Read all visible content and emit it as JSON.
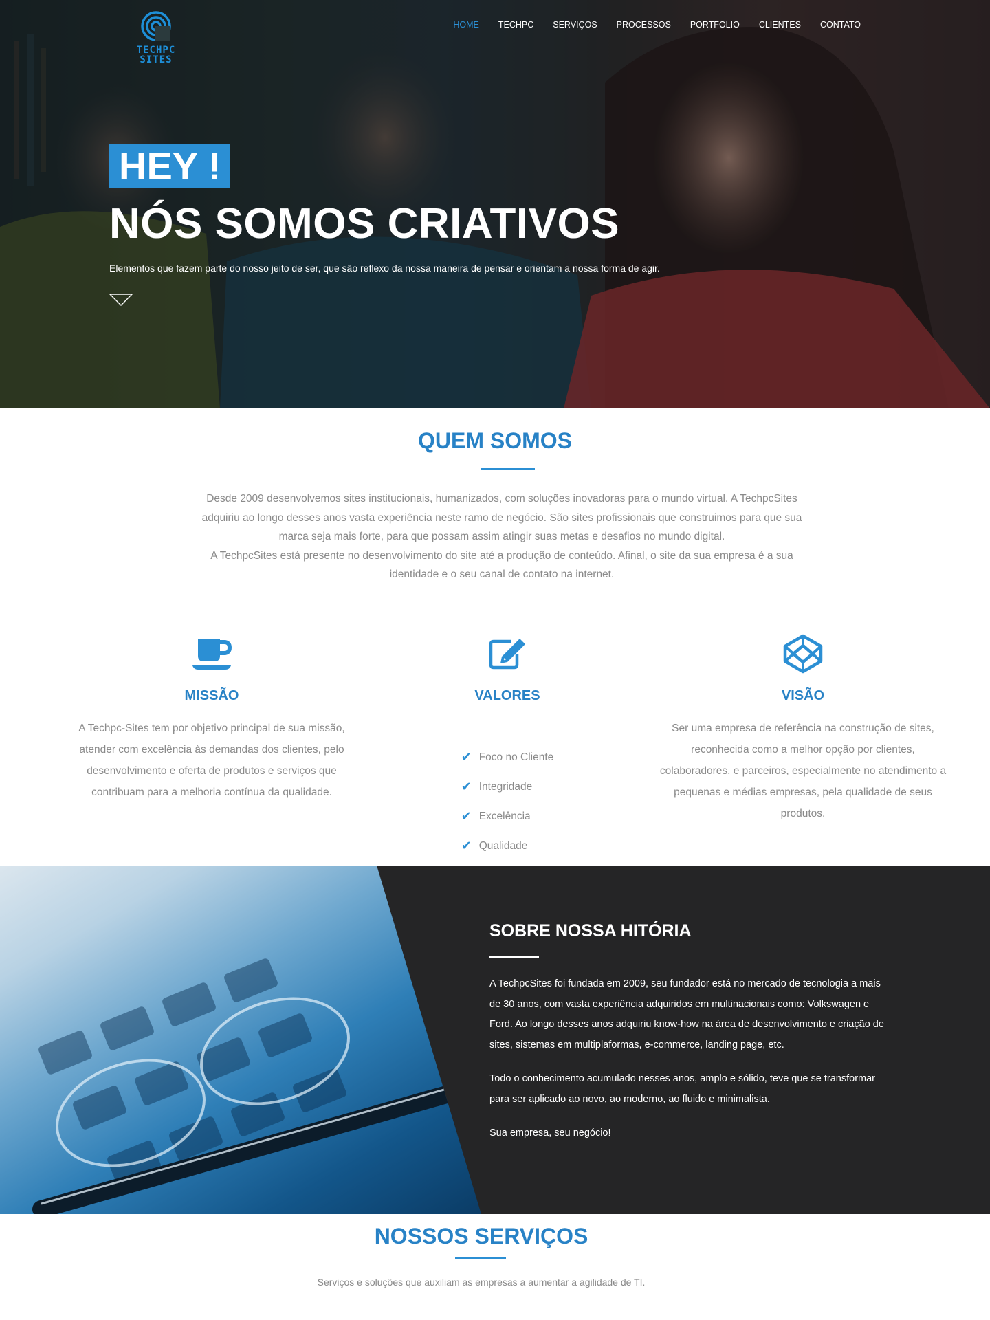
{
  "brand": {
    "logo_text": "TECHPC SITES",
    "accent": "#2b8fd4",
    "title_blue": "#2882c6"
  },
  "nav": {
    "items": [
      {
        "label": "HOME",
        "active": true
      },
      {
        "label": "TECHPC"
      },
      {
        "label": "SERVIÇOS"
      },
      {
        "label": "PROCESSOS"
      },
      {
        "label": "PORTFOLIO"
      },
      {
        "label": "CLIENTES"
      },
      {
        "label": "CONTATO"
      }
    ]
  },
  "hero": {
    "badge": "HEY !",
    "title": "NÓS SOMOS CRIATIVOS",
    "subtitle": "Elementos que fazem parte do nosso jeito de ser, que são reflexo da nossa maneira de pensar e orientam a nossa forma de agir.",
    "arrow_icon": "chevron-down-outline-icon"
  },
  "about": {
    "title": "QUEM SOMOS",
    "text_1": "Desde 2009 desenvolvemos sites institucionais, humanizados, com soluções inovadoras para o mundo virtual. A TechpcSites adquiriu ao longo desses anos vasta experiência neste ramo de negócio. São sites profissionais que construimos para que sua marca seja mais forte, para que possam assim atingir suas metas e desafios no mundo digital.",
    "text_2": "A TechpcSites está presente no desenvolvimento do site até a produção de conteúdo. Afinal, o site da sua empresa é a sua identidade e o seu canal de contato na internet."
  },
  "missao": {
    "icon": "coffee-cup-icon",
    "title": "MISSÃO",
    "text": "A Techpc-Sites tem por objetivo principal de sua missão, atender com excelência às demandas dos clientes, pelo desenvolvimento e oferta de produtos e serviços que contribuam para a melhoria contínua da qualidade."
  },
  "valores": {
    "icon": "edit-pencil-icon",
    "title": "VALORES",
    "items": [
      "Foco no Cliente",
      "Integridade",
      "Excelência",
      "Qualidade"
    ]
  },
  "visao": {
    "icon": "codepen-cube-icon",
    "title": "VISÃO",
    "text": "Ser uma empresa de referência na construção de sites, reconhecida como a melhor opção por clientes, colaboradores, e parceiros, especialmente no atendimento a pequenas e médias empresas, pela qualidade de seus produtos."
  },
  "history": {
    "title": "SOBRE NOSSA HITÓRIA",
    "p1": "A TechpcSites foi fundada em 2009, seu fundador está no mercado de tecnologia a mais de 30 anos, com vasta experiência adquiridos em multinacionais como: Volkswagen e Ford. Ao longo desses anos adquiriu know-how na área de desenvolvimento e criação de sites, sistemas em multiplaformas, e-commerce, landing page, etc.",
    "p2": "Todo o conhecimento acumulado nesses anos, amplo e sólido, teve que se transformar para ser aplicado ao novo, ao moderno, ao fluido e minimalista.",
    "p3": "Sua empresa, seu negócio!"
  },
  "services": {
    "title": "NOSSOS SERVIÇOS",
    "subtitle": "Serviços e soluções que auxiliam as empresas a aumentar a agilidade de TI."
  }
}
